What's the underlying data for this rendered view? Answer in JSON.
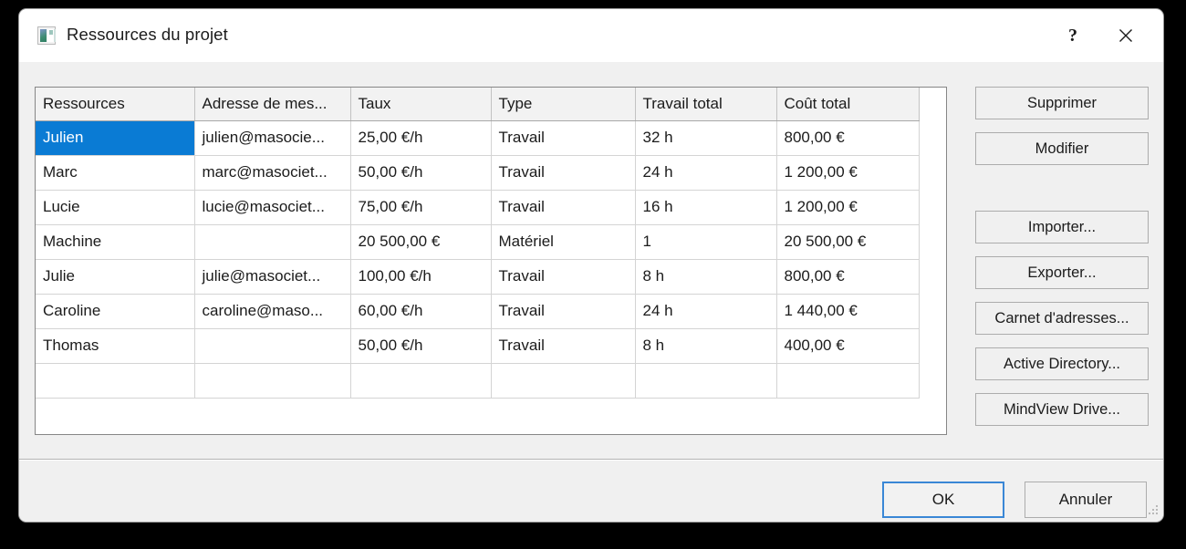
{
  "window": {
    "title": "Ressources du projet",
    "icon": "project-resources-icon",
    "help_label": "?",
    "close_label": "✕"
  },
  "table": {
    "columns": [
      "Ressources",
      "Adresse de mes...",
      "Taux",
      "Type",
      "Travail total",
      "Coût total"
    ],
    "rows": [
      {
        "resource": "Julien",
        "email": "julien@masocie...",
        "rate": "25,00 €/h",
        "type": "Travail",
        "work": "32 h",
        "cost": "800,00 €",
        "selected": true
      },
      {
        "resource": "Marc",
        "email": "marc@masociet...",
        "rate": "50,00 €/h",
        "type": "Travail",
        "work": "24 h",
        "cost": "1 200,00 €",
        "selected": false
      },
      {
        "resource": "Lucie",
        "email": "lucie@masociet...",
        "rate": "75,00 €/h",
        "type": "Travail",
        "work": "16 h",
        "cost": "1 200,00 €",
        "selected": false
      },
      {
        "resource": "Machine",
        "email": "",
        "rate": "20 500,00 €",
        "type": "Matériel",
        "work": "1",
        "cost": "20 500,00 €",
        "selected": false
      },
      {
        "resource": "Julie",
        "email": "julie@masociet...",
        "rate": "100,00 €/h",
        "type": "Travail",
        "work": "8 h",
        "cost": "800,00 €",
        "selected": false
      },
      {
        "resource": "Caroline",
        "email": "caroline@maso...",
        "rate": "60,00 €/h",
        "type": "Travail",
        "work": "24 h",
        "cost": "1 440,00 €",
        "selected": false
      },
      {
        "resource": "Thomas",
        "email": "",
        "rate": "50,00 €/h",
        "type": "Travail",
        "work": "8 h",
        "cost": "400,00 €",
        "selected": false
      },
      {
        "resource": "",
        "email": "",
        "rate": "",
        "type": "",
        "work": "",
        "cost": "",
        "selected": false
      }
    ]
  },
  "side_buttons": [
    {
      "label": "Supprimer"
    },
    {
      "label": "Modifier"
    },
    {
      "label": "Importer..."
    },
    {
      "label": "Exporter..."
    },
    {
      "label": "Carnet d'adresses..."
    },
    {
      "label": "Active Directory..."
    },
    {
      "label": "MindView Drive..."
    }
  ],
  "footer": {
    "ok_label": "OK",
    "cancel_label": "Annuler"
  },
  "colors": {
    "selection": "#0a7bd4",
    "default_button_border": "#3a87d6",
    "dialog_background": "#f0f0f0",
    "titlebar_background": "#ffffff"
  }
}
